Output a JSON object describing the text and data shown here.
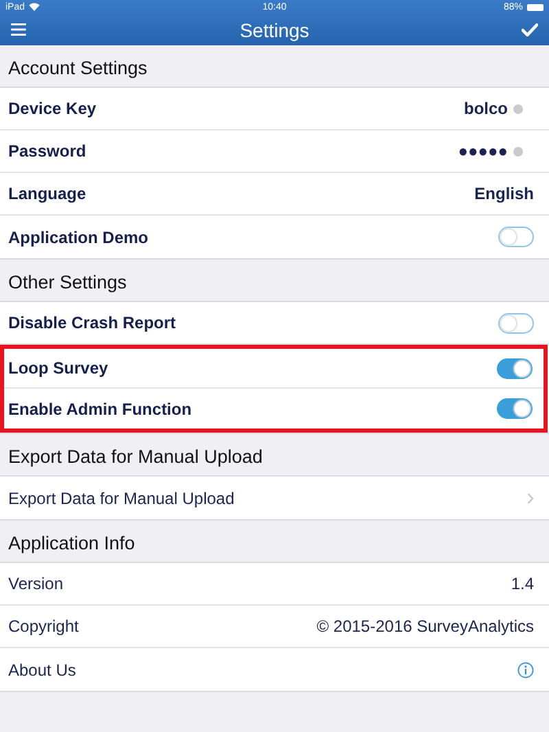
{
  "status_bar": {
    "device": "iPad",
    "time": "10:40",
    "battery": "88%"
  },
  "nav_bar": {
    "title": "Settings"
  },
  "sections": [
    {
      "title": "Account Settings",
      "bold_labels": true,
      "items": [
        {
          "kind": "field",
          "label": "Device Key",
          "value": "bolco",
          "highlighted": false
        },
        {
          "kind": "field",
          "label": "Password",
          "value": "●●●●●",
          "highlighted": false
        },
        {
          "kind": "value",
          "label": "Language",
          "value": "English",
          "highlighted": false
        },
        {
          "kind": "toggle",
          "label": "Application Demo",
          "on": false,
          "highlighted": false
        }
      ]
    },
    {
      "title": "Other Settings",
      "bold_labels": true,
      "items": [
        {
          "kind": "toggle",
          "label": "Disable Crash Report",
          "on": false,
          "highlighted": false
        },
        {
          "kind": "toggle",
          "label": "Loop Survey",
          "on": true,
          "highlighted": true
        },
        {
          "kind": "toggle",
          "label": "Enable Admin Function",
          "on": true,
          "highlighted": true
        }
      ]
    },
    {
      "title": "Export Data for Manual Upload",
      "bold_labels": false,
      "items": [
        {
          "kind": "link",
          "label": "Export Data for Manual Upload",
          "highlighted": false
        }
      ]
    },
    {
      "title": "Application Info",
      "bold_labels": false,
      "items": [
        {
          "kind": "value",
          "label": "Version",
          "value": "1.4",
          "highlighted": false
        },
        {
          "kind": "value",
          "label": "Copyright",
          "value": "© 2015-2016 SurveyAnalytics",
          "highlighted": false
        },
        {
          "kind": "info",
          "label": "About Us",
          "highlighted": false
        }
      ]
    }
  ]
}
